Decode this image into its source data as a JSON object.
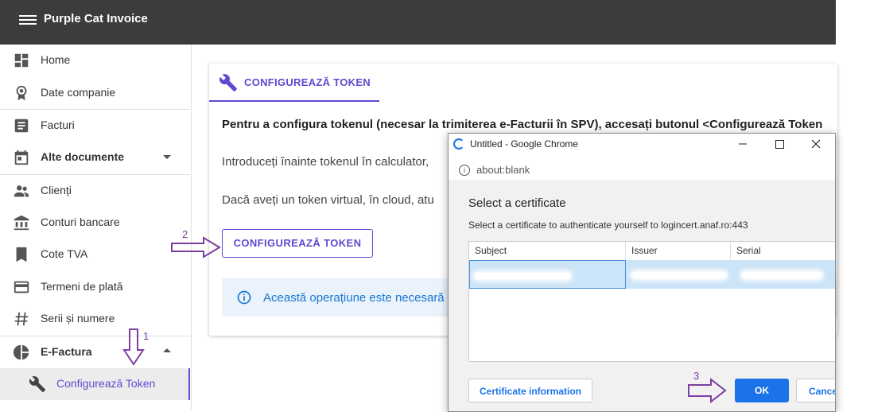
{
  "app": {
    "title": "Purple Cat Invoice"
  },
  "sidebar": {
    "items": [
      {
        "label": "Home"
      },
      {
        "label": "Date companie"
      },
      {
        "label": "Facturi"
      },
      {
        "label": "Alte documente"
      },
      {
        "label": "Clienți"
      },
      {
        "label": "Conturi bancare"
      },
      {
        "label": "Cote TVA"
      },
      {
        "label": "Termeni de plată"
      },
      {
        "label": "Serii și numere"
      },
      {
        "label": "E-Factura"
      },
      {
        "label": "Configurează Token"
      }
    ]
  },
  "main": {
    "tab_label": "CONFIGUREAZĂ TOKEN",
    "paragraph1": "Pentru a configura tokenul (necesar la trimiterea e-Facturii în SPV), accesați butonul <Configurează Token",
    "paragraph2": "Introduceți înainte tokenul în calculator,",
    "paragraph3": "Dacă aveți un token virtual, în cloud, atu",
    "button_label": "CONFIGUREAZĂ TOKEN",
    "info_text": "Această operațiune este necesară o s"
  },
  "chrome_window": {
    "title": "Untitled - Google Chrome",
    "url": "about:blank",
    "minimize": "—",
    "maximize": "☐",
    "close": "✕"
  },
  "cert_dialog": {
    "heading": "Select a certificate",
    "subtitle": "Select a certificate to authenticate yourself to logincert.anaf.ro:443",
    "columns": [
      "Subject",
      "Issuer",
      "Serial"
    ],
    "info_button": "Certificate information",
    "ok_button": "OK",
    "cancel_button": "Cance"
  },
  "annotations": {
    "step1": "1",
    "step2": "2",
    "step3": "3"
  },
  "colors": {
    "accent": "#5c4bd1",
    "appbar": "#3c3c3c",
    "chrome_blue": "#1a73e8",
    "arrow": "#7b3fa0"
  }
}
